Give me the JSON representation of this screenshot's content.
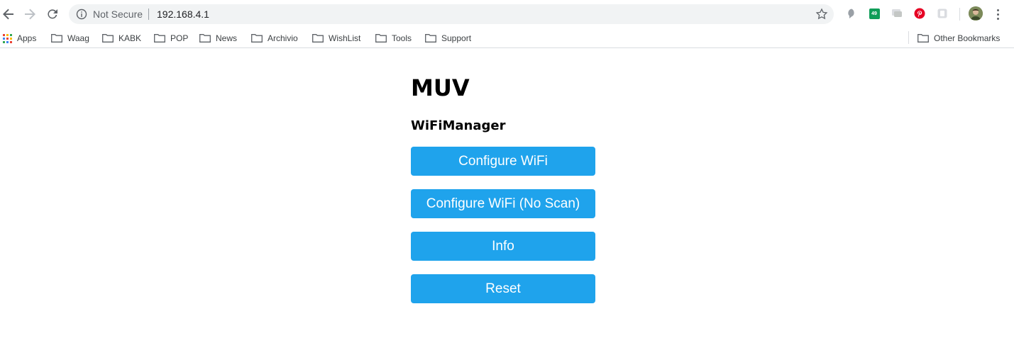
{
  "browser": {
    "omnibox": {
      "security_label": "Not Secure",
      "url": "192.168.4.1"
    },
    "extensions": [
      {
        "icon": "speech-bubble-icon"
      },
      {
        "icon": "badge-icon",
        "badge": "49"
      },
      {
        "icon": "chat-icon"
      },
      {
        "icon": "pinterest-icon"
      },
      {
        "icon": "b-icon"
      }
    ],
    "bookmarks": {
      "apps_label": "Apps",
      "folders": [
        "Waag",
        "KABK",
        "POP",
        "News",
        "Archivio",
        "WishList",
        "Tools",
        "Support"
      ],
      "other_label": "Other Bookmarks"
    }
  },
  "page": {
    "title": "MUV",
    "subtitle": "WiFiManager",
    "buttons": [
      "Configure WiFi",
      "Configure WiFi (No Scan)",
      "Info",
      "Reset"
    ],
    "button_color": "#1fa3ec"
  }
}
